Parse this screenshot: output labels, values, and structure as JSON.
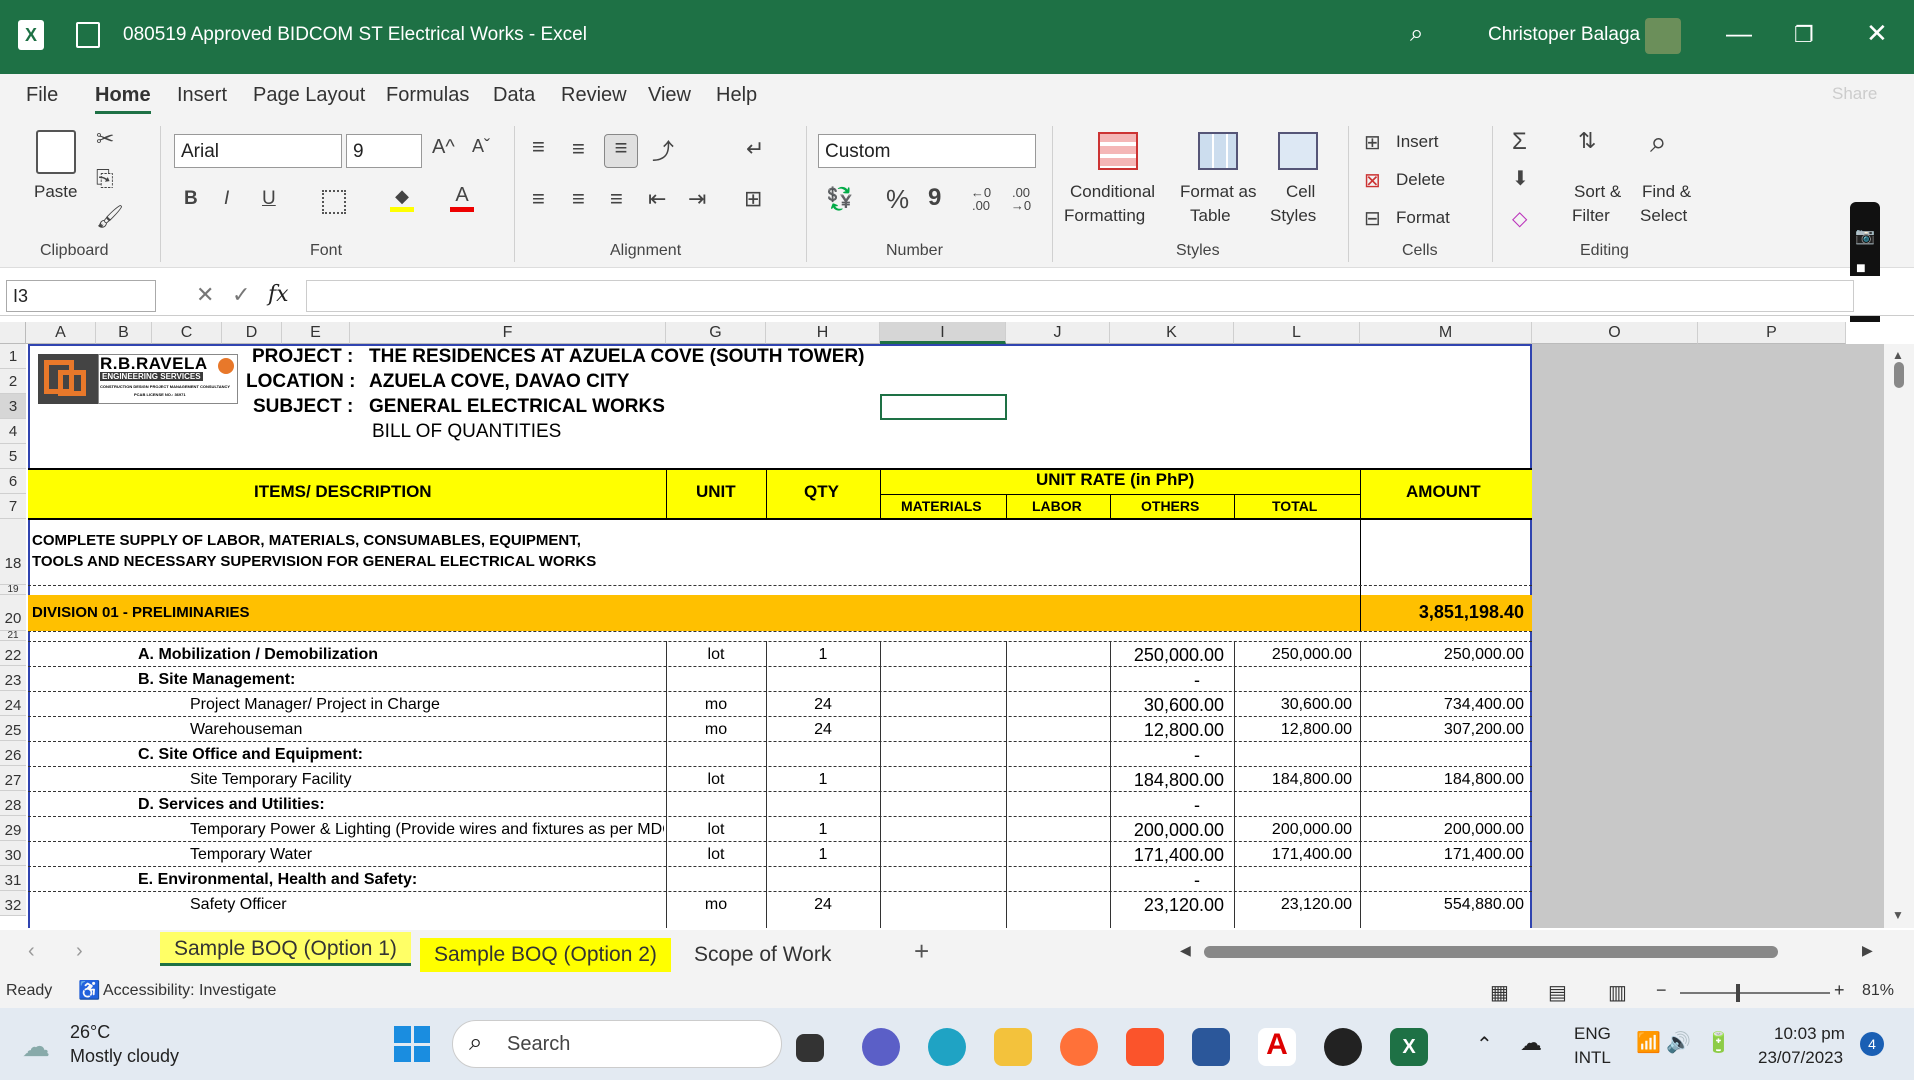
{
  "window": {
    "title": "080519 Approved BIDCOM ST Electrical Works  -  Excel",
    "user": "Christoper Balaga",
    "minimize": "—",
    "restore": "❐",
    "close": "✕",
    "share": "Share"
  },
  "menu": [
    "File",
    "Home",
    "Insert",
    "Page Layout",
    "Formulas",
    "Data",
    "Review",
    "View",
    "Help"
  ],
  "ribbon": {
    "clipboard": {
      "paste": "Paste",
      "group": "Clipboard"
    },
    "font": {
      "name": "Arial",
      "size": "9",
      "bold": "B",
      "italic": "I",
      "underline": "U",
      "group": "Font",
      "grow": "A^",
      "shrink": "Aˇ"
    },
    "alignment": {
      "group": "Alignment"
    },
    "number": {
      "format": "Custom",
      "percent": "%",
      "comma": "9",
      "group": "Number",
      "inc_decimal": "←0 .00",
      "dec_decimal": ".00 →0"
    },
    "styles": {
      "conditional": [
        "Conditional",
        "Formatting"
      ],
      "format_table": [
        "Format as",
        "Table"
      ],
      "cell_styles": [
        "Cell",
        "Styles"
      ],
      "group": "Styles"
    },
    "cells": {
      "insert": "Insert",
      "delete": "Delete",
      "format": "Format",
      "group": "Cells"
    },
    "editing": {
      "sort": [
        "Sort &",
        "Filter"
      ],
      "find": [
        "Find &",
        "Select"
      ],
      "group": "Editing"
    }
  },
  "formula_bar": {
    "name_box": "I3",
    "fx": "fx",
    "value": ""
  },
  "columns": [
    "A",
    "B",
    "C",
    "D",
    "E",
    "F",
    "G",
    "H",
    "I",
    "J",
    "K",
    "L",
    "M",
    "O",
    "P"
  ],
  "rows": [
    "1",
    "2",
    "3",
    "4",
    "5",
    "6",
    "7",
    "18",
    "19",
    "20",
    "21",
    "22",
    "23",
    "24",
    "25",
    "26",
    "27",
    "28",
    "29",
    "30",
    "31",
    "32"
  ],
  "sheet": {
    "company": "R.B.RAVELA",
    "company_sub": "ENGINEERING SERVICES",
    "company_tag": "CONSTRUCTION DESIGN  PROJECT MANAGEMENT  CONSULTANCY",
    "license": "PCAB LICENSE NO.: 36971",
    "project_label": "PROJECT :",
    "project": "THE RESIDENCES AT AZUELA COVE (SOUTH TOWER)",
    "location_label": "LOCATION :",
    "location": "AZUELA COVE, DAVAO CITY",
    "subject_label": "SUBJECT :",
    "subject": "GENERAL ELECTRICAL WORKS",
    "boq": "BILL OF QUANTITIES",
    "hdr_items": "ITEMS/ DESCRIPTION",
    "hdr_unit": "UNIT",
    "hdr_qty": "QTY",
    "hdr_unit_rate": "UNIT RATE (in PhP)",
    "hdr_materials": "MATERIALS",
    "hdr_labor": "LABOR",
    "hdr_others": "OTHERS",
    "hdr_total": "TOTAL",
    "hdr_amount": "AMOUNT",
    "scope_line1": "COMPLETE SUPPLY OF LABOR, MATERIALS, CONSUMABLES, EQUIPMENT,",
    "scope_line2": "TOOLS AND NECESSARY SUPERVISION FOR GENERAL ELECTRICAL WORKS",
    "division": "DIVISION 01 - PRELIMINARIES",
    "division_amount": "3,851,198.40",
    "items": [
      {
        "desc": "A.  Mobilization / Demobilization",
        "unit": "lot",
        "qty": "1",
        "others": "250,000.00",
        "total": "250,000.00",
        "amount": "250,000.00"
      },
      {
        "desc": "B.  Site Management:",
        "unit": "",
        "qty": "",
        "others": "-",
        "total": "",
        "amount": ""
      },
      {
        "desc": "Project Manager/ Project in Charge",
        "unit": "mo",
        "qty": "24",
        "others": "30,600.00",
        "total": "30,600.00",
        "amount": "734,400.00"
      },
      {
        "desc": "Warehouseman",
        "unit": "mo",
        "qty": "24",
        "others": "12,800.00",
        "total": "12,800.00",
        "amount": "307,200.00"
      },
      {
        "desc": "C.  Site Office and Equipment:",
        "unit": "",
        "qty": "",
        "others": "-",
        "total": "",
        "amount": ""
      },
      {
        "desc": "Site Temporary Facility",
        "unit": "lot",
        "qty": "1",
        "others": "184,800.00",
        "total": "184,800.00",
        "amount": "184,800.00"
      },
      {
        "desc": "D.  Services and Utilities:",
        "unit": "",
        "qty": "",
        "others": "-",
        "total": "",
        "amount": ""
      },
      {
        "desc": "Temporary Power & Lighting (Provide wires and fixtures as per MDC",
        "unit": "lot",
        "qty": "1",
        "others": "200,000.00",
        "total": "200,000.00",
        "amount": "200,000.00"
      },
      {
        "desc": "Temporary Water",
        "unit": "lot",
        "qty": "1",
        "others": "171,400.00",
        "total": "171,400.00",
        "amount": "171,400.00"
      },
      {
        "desc": "E.  Environmental, Health and Safety:",
        "unit": "",
        "qty": "",
        "others": "-",
        "total": "",
        "amount": ""
      },
      {
        "desc": "Safety Officer",
        "unit": "mo",
        "qty": "24",
        "others": "23,120.00",
        "total": "23,120.00",
        "amount": "554,880.00"
      }
    ]
  },
  "tabs": [
    "Sample BOQ (Option 1)",
    "Sample BOQ (Option 2)",
    "Scope of Work"
  ],
  "status": {
    "ready": "Ready",
    "accessibility": "Accessibility: Investigate",
    "zoom": "81%"
  },
  "taskbar": {
    "temp": "26°C",
    "weather": "Mostly cloudy",
    "search": "Search",
    "lang1": "ENG",
    "lang2": "INTL",
    "time": "10:03 pm",
    "date": "23/07/2023",
    "badge": "4"
  },
  "colors": {
    "excel_green": "#1e7145",
    "header_yellow": "#ffff00",
    "division_orange": "#ffc000"
  }
}
